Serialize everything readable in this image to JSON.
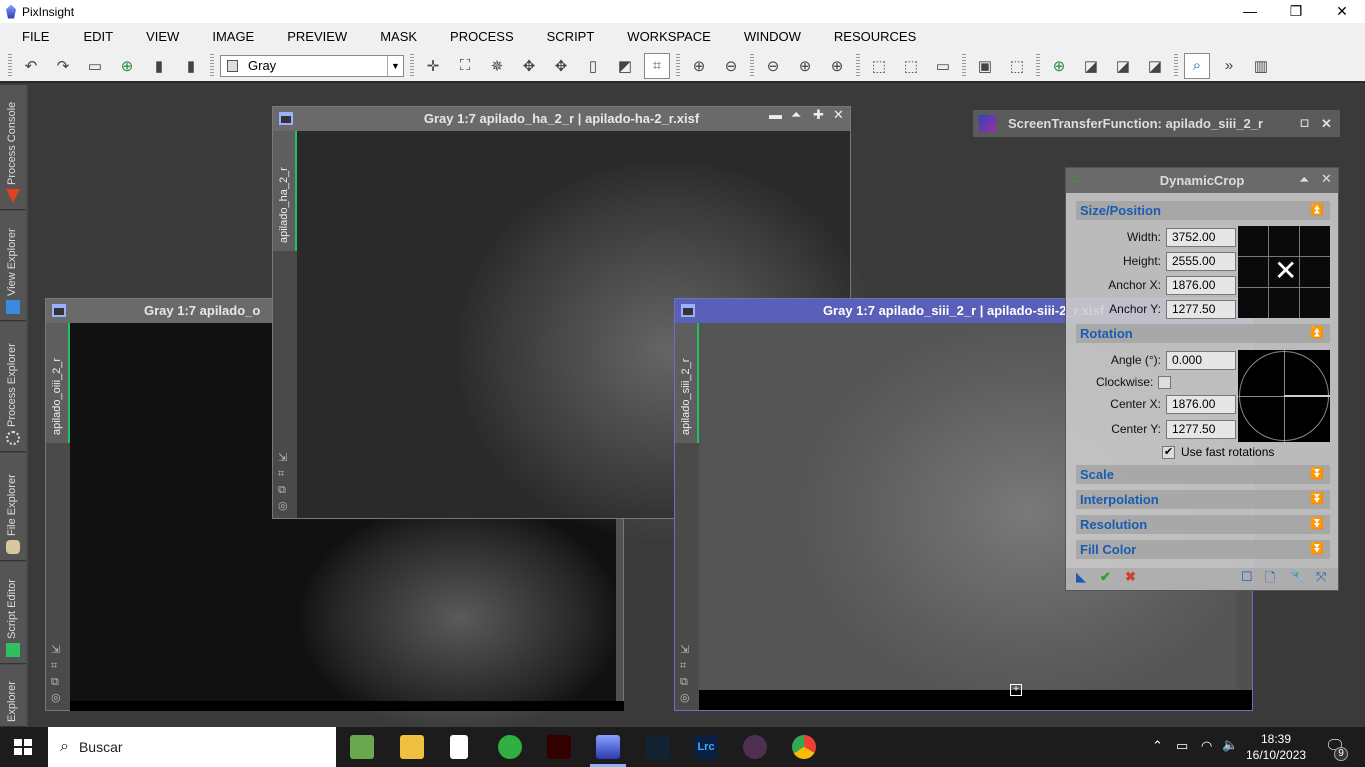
{
  "app": {
    "title": "PixInsight",
    "window_controls": [
      "—",
      "❐",
      "✕"
    ]
  },
  "menu": [
    "FILE",
    "EDIT",
    "VIEW",
    "IMAGE",
    "PREVIEW",
    "MASK",
    "PROCESS",
    "SCRIPT",
    "WORKSPACE",
    "WINDOW",
    "RESOURCES"
  ],
  "toolbar": {
    "colorspace_select": "Gray",
    "overflow": "»"
  },
  "left_tabs": [
    "Process Console",
    "View Explorer",
    "Process Explorer",
    "File Explorer",
    "Script Editor",
    "Explorer"
  ],
  "windows": [
    {
      "title": "Gray 1:7 apilado_o",
      "tab": "apilado_oiii_2_r"
    },
    {
      "title": "Gray 1:7 apilado_ha_2_r | apilado-ha-2_r.xisf",
      "tab": "apilado_ha_2_r"
    },
    {
      "title": "Gray 1:7 apilado_siii_2_r | apilado-siii-2_r.xisf",
      "tab": "apilado_siii_2_r"
    }
  ],
  "stf": {
    "title": "ScreenTransferFunction: apilado_siii_2_r"
  },
  "dynamic_crop": {
    "title": "DynamicCrop",
    "sections": {
      "size": "Size/Position",
      "rotation": "Rotation",
      "scale": "Scale",
      "interpolation": "Interpolation",
      "resolution": "Resolution",
      "fill": "Fill Color"
    },
    "fields": {
      "width": {
        "label": "Width:",
        "value": "3752.00"
      },
      "height": {
        "label": "Height:",
        "value": "2555.00"
      },
      "anchor_x": {
        "label": "Anchor X:",
        "value": "1876.00"
      },
      "anchor_y": {
        "label": "Anchor Y:",
        "value": "1277.50"
      },
      "angle": {
        "label": "Angle (°):",
        "value": "0.000"
      },
      "clockwise": {
        "label": "Clockwise:",
        "checked": false
      },
      "center_x": {
        "label": "Center X:",
        "value": "1876.00"
      },
      "center_y": {
        "label": "Center Y:",
        "value": "1277.50"
      },
      "fast_rotations": {
        "label": "Use fast rotations",
        "checked": true
      }
    }
  },
  "taskbar": {
    "search_placeholder": "Buscar",
    "time": "18:39",
    "date": "16/10/2023",
    "notifications": "9"
  }
}
